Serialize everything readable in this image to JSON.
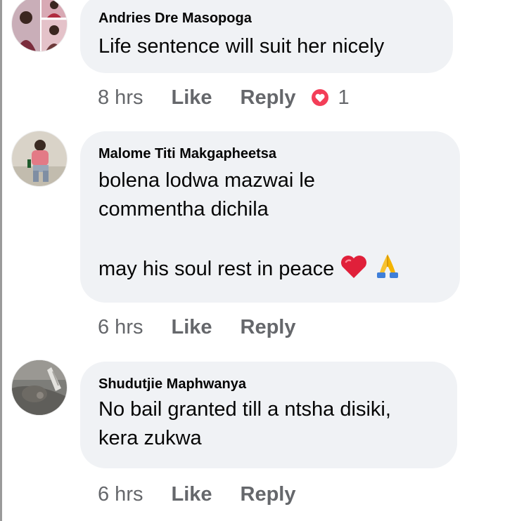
{
  "comments": [
    {
      "author": "Andries Dre Masopoga",
      "text": "Life sentence will suit her nicely",
      "time": "8 hrs",
      "like_label": "Like",
      "reply_label": "Reply",
      "reaction": {
        "icon": "love-reaction-icon",
        "count": "1",
        "color": "#f33e58"
      }
    },
    {
      "author": "Malome Titi Makgapheetsa",
      "text_lines": [
        "bolena lodwa mazwai le",
        "commentha dichila",
        "",
        "may his soul rest in peace"
      ],
      "emojis": [
        "red-heart-emoji-icon",
        "folded-hands-emoji-icon"
      ],
      "time": "6 hrs",
      "like_label": "Like",
      "reply_label": "Reply"
    },
    {
      "author": "Shudutjie Maphwanya",
      "text": "No bail granted till a ntsha disiki,\nkera zukwa",
      "time": "6 hrs",
      "like_label": "Like",
      "reply_label": "Reply"
    }
  ],
  "colors": {
    "bubble_bg": "#f0f2f5",
    "meta_text": "#65676b",
    "body_text": "#050505"
  }
}
